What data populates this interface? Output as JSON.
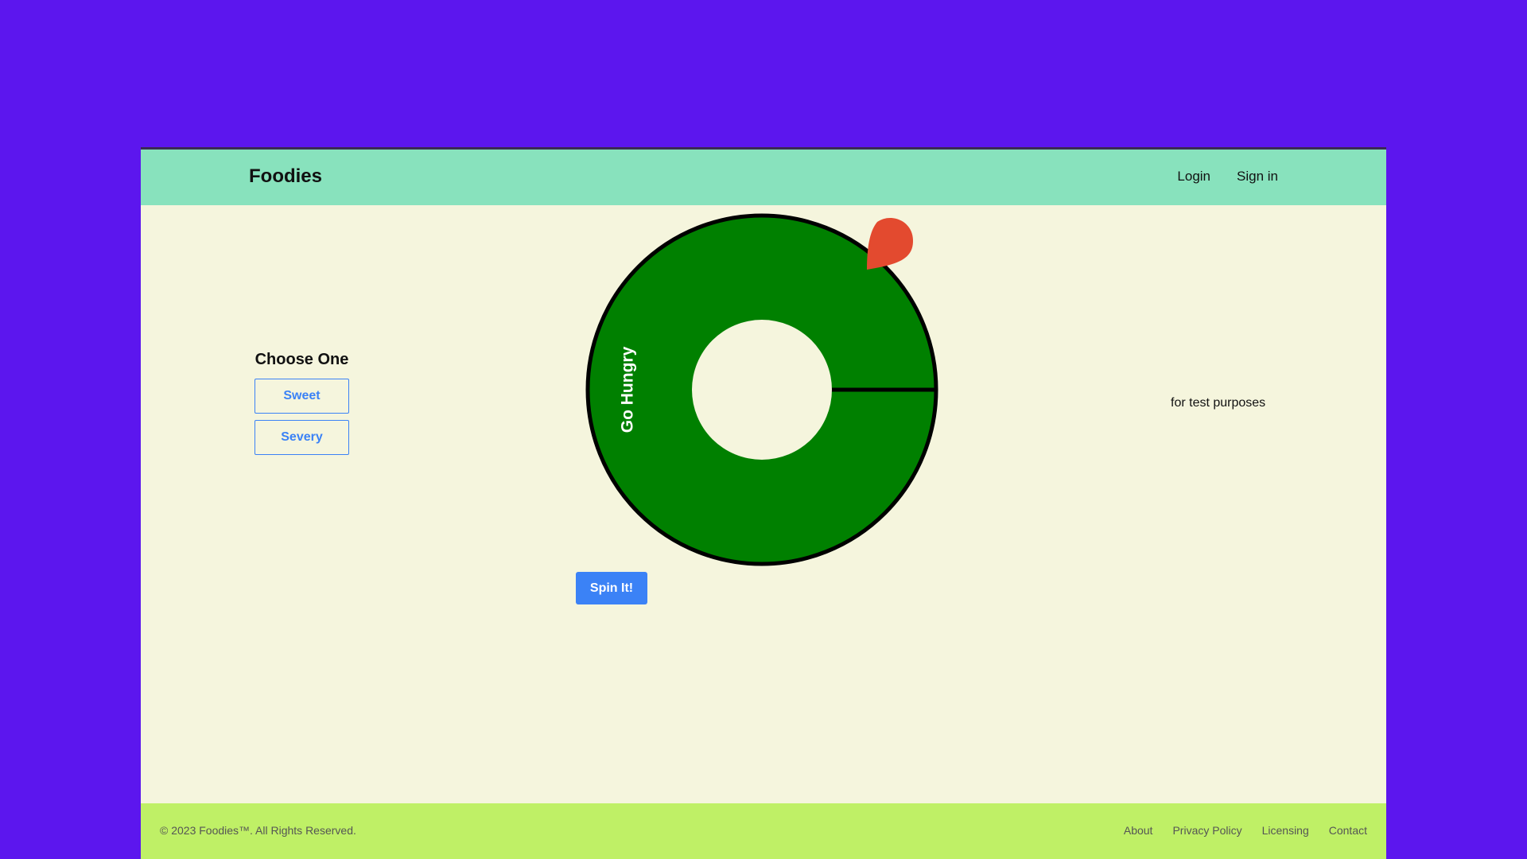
{
  "colors": {
    "page_background": "#5c16ee",
    "content_background": "#f5f5dd",
    "navbar": "#88e2bd",
    "footer": "#bff066",
    "wheel_segment": "#008000",
    "pointer": "#e34a2f",
    "accent": "#3b82f6"
  },
  "navbar": {
    "brand": "Foodies",
    "links": [
      "Login",
      "Sign in"
    ]
  },
  "choose": {
    "title": "Choose One",
    "options": [
      "Sweet",
      "Severy"
    ]
  },
  "wheel": {
    "segments": [
      {
        "label": "Go Hungry",
        "color": "#008000"
      }
    ],
    "pointer_icon": "pin-pointer-icon"
  },
  "spin_button": {
    "label": "Spin It!"
  },
  "side_note": "for test purposes",
  "footer": {
    "copyright": "© 2023 Foodies™. All Rights Reserved.",
    "links": [
      "About",
      "Privacy Policy",
      "Licensing",
      "Contact"
    ]
  }
}
